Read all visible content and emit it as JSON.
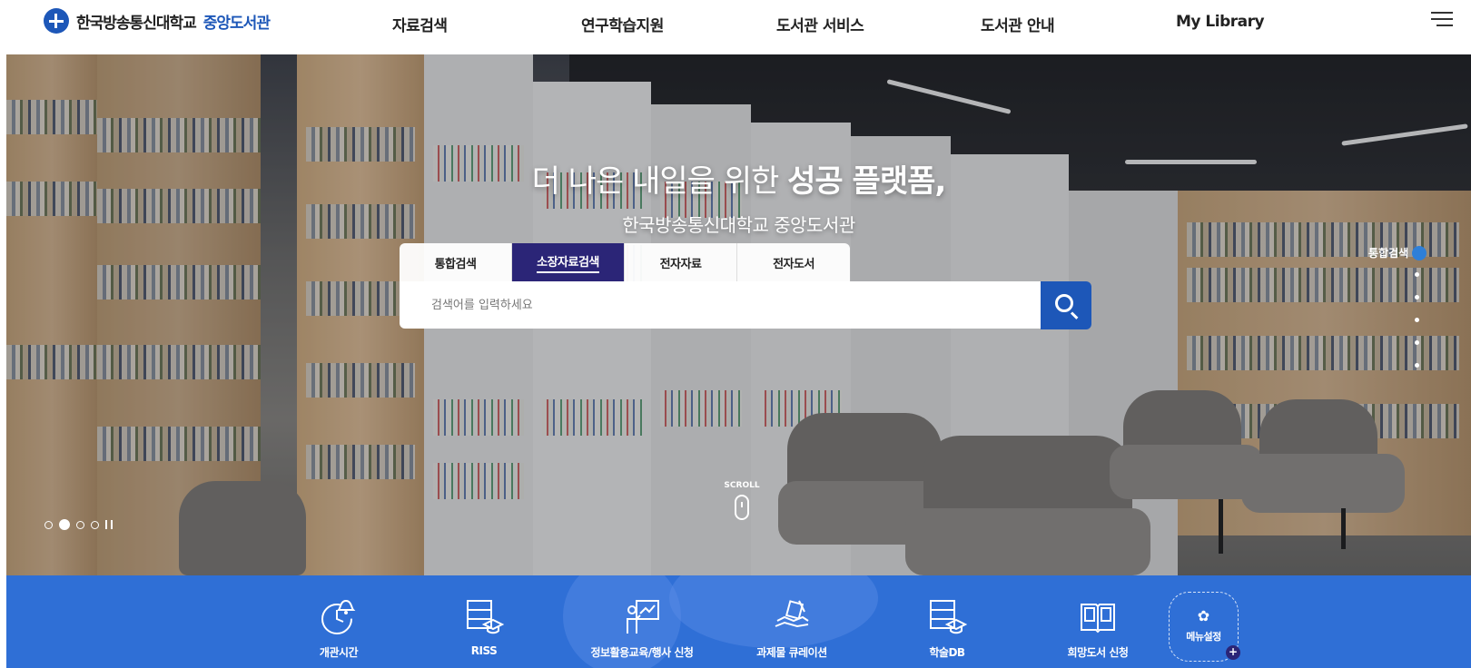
{
  "header": {
    "logo_text": "한국방송통신대학교",
    "logo_accent": "중앙도서관",
    "nav": [
      "자료검색",
      "연구학습지원",
      "도서관 서비스",
      "도서관 안내",
      "My Library"
    ]
  },
  "hero": {
    "title_normal": "더 나은 내일을 위한 ",
    "title_bold": "성공 플랫폼,",
    "subtitle": "한국방송통신대학교 중앙도서관",
    "scroll_label": "SCROLL",
    "side_quick_label": "통합검색"
  },
  "search": {
    "tabs": [
      "통합검색",
      "소장자료검색",
      "전자자료",
      "전자도서"
    ],
    "active_tab": "소장자료검색",
    "placeholder": "검색어를 입력하세요"
  },
  "quick_menu": {
    "items": [
      {
        "label": "개관시간",
        "icon": "clock-bell-icon"
      },
      {
        "label": "RISS",
        "icon": "database-grad-cap-icon"
      },
      {
        "label": "정보활용교육/행사 신청",
        "icon": "presenter-board-icon"
      },
      {
        "label": "과제물 큐레이션",
        "icon": "hand-paper-icon"
      },
      {
        "label": "학술DB",
        "icon": "database-grad-cap-icon"
      },
      {
        "label": "희망도서 신청",
        "icon": "open-book-icon"
      }
    ],
    "settings_label": "메뉴설정"
  },
  "colors": {
    "primary_blue": "#1d57b8",
    "quickbar_blue": "#2f6fd6",
    "active_tab": "#2b2577"
  }
}
